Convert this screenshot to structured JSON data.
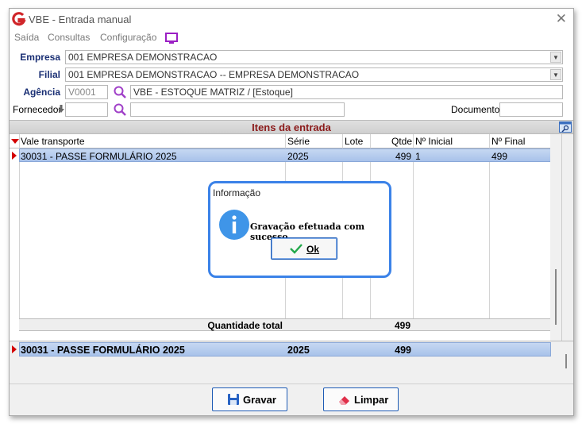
{
  "window": {
    "title": "VBE - Entrada manual",
    "close_glyph": "✕"
  },
  "menu": [
    {
      "label": "Saída"
    },
    {
      "label": "Consultas"
    },
    {
      "label": "Configuração"
    }
  ],
  "form": {
    "empresa_label": "Empresa",
    "empresa_value": "001 EMPRESA DEMONSTRACAO",
    "filial_label": "Filial",
    "filial_value": "001 EMPRESA DEMONSTRACAO -- EMPRESA DEMONSTRACAO",
    "agencia_label": "Agência",
    "agencia_code": "V0001",
    "agencia_desc": "VBE - ESTOQUE MATRIZ / [Estoque]",
    "fornecedor_label": "Fornecedor",
    "fornecedor_code": "",
    "fornecedor_desc": "",
    "documento_label": "Documento",
    "documento_value": ""
  },
  "items": {
    "title": "Itens da entrada",
    "columns": [
      "Vale transporte",
      "Série",
      "Lote",
      "Qtde",
      "Nº Inicial",
      "Nº Final"
    ],
    "rows": [
      {
        "vale": "30031 - PASSE FORMULÁRIO 2025",
        "serie": "2025",
        "lote": "",
        "qtde": "499",
        "inicial": "1",
        "final": "499"
      }
    ],
    "total_label": "Quantidade total",
    "total_value": "499"
  },
  "summary": {
    "vale": "30031 - PASSE FORMULÁRIO 2025",
    "serie": "2025",
    "qtde": "499"
  },
  "buttons": {
    "gravar": "Gravar",
    "limpar": "Limpar"
  },
  "dialog": {
    "title": "Informação",
    "message": "Gravação efetuada com sucesso.",
    "ok_label": "Ok"
  },
  "colors": {
    "accent": "#3b82e8",
    "section_title": "#8b1a1a",
    "label": "#1a2f74",
    "selection": "#b4cbee"
  }
}
